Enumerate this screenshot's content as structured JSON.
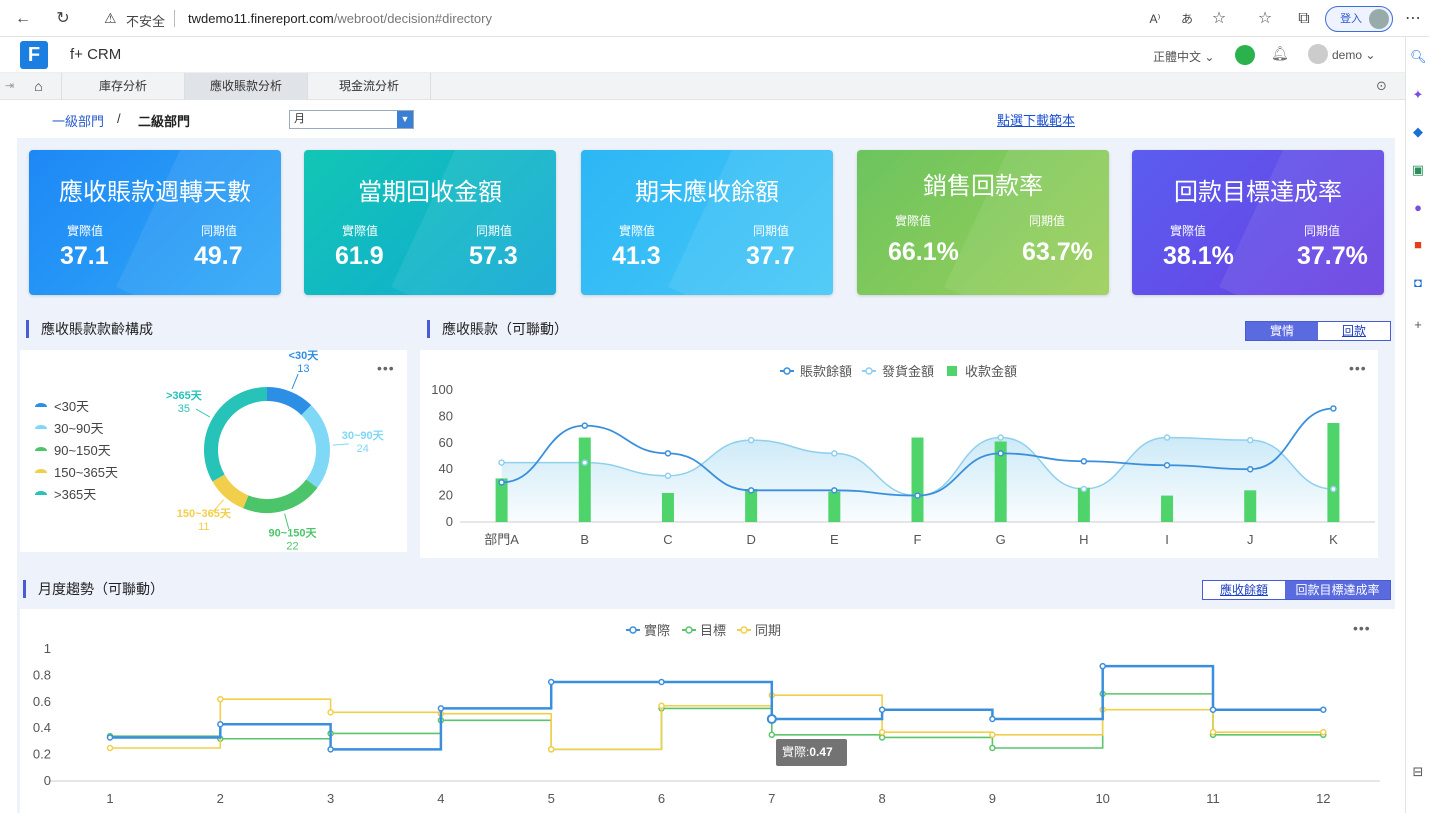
{
  "browser": {
    "insecure_label": "不安全",
    "url_host": "twdemo11.finereport.com",
    "url_path": "/webroot/decision#directory",
    "login_label": "登入"
  },
  "header": {
    "app_title": "f+ CRM",
    "language": "正體中文",
    "username": "demo"
  },
  "tabs": [
    {
      "label": "庫存分析",
      "active": false
    },
    {
      "label": "應收賬款分析",
      "active": true
    },
    {
      "label": "現金流分析",
      "active": false
    }
  ],
  "filters": {
    "breadcrumb_1": "一級部門",
    "breadcrumb_sep": "/",
    "breadcrumb_2": "二級部門",
    "period_value": "月",
    "download_link": "點選下載範本"
  },
  "kpis": [
    {
      "title": "應收賬款週轉天數",
      "actual_label": "實際值",
      "actual": "37.1",
      "prior_label": "同期值",
      "prior": "49.7",
      "color_a": "#1e88f5",
      "color_b": "#2fa8f7"
    },
    {
      "title": "當期回收金額",
      "actual_label": "實際值",
      "actual": "61.9",
      "prior_label": "同期值",
      "prior": "57.3",
      "color_a": "#12c6b4",
      "color_b": "#10a8d6"
    },
    {
      "title": "期末應收餘額",
      "actual_label": "實際值",
      "actual": "41.3",
      "prior_label": "同期值",
      "prior": "37.7",
      "color_a": "#2cb6f5",
      "color_b": "#46c8f7"
    },
    {
      "title": "銷售回款率",
      "actual_label": "實際值",
      "actual": "66.1%",
      "prior_label": "同期值",
      "prior": "63.7%",
      "color_a": "#6cc45e",
      "color_b": "#9ccf5a"
    },
    {
      "title": "回款目標達成率",
      "actual_label": "實際值",
      "actual": "38.1%",
      "prior_label": "同期值",
      "prior": "37.7%",
      "color_a": "#5a5ef0",
      "color_b": "#6a3ee0"
    }
  ],
  "sections": {
    "aging_title": "應收賬款款齡構成",
    "receivables_title": "應收賬款（可聯動）",
    "monthly_title": "月度趨勢（可聯動）",
    "receivables_toggle": [
      "實情",
      "回款"
    ],
    "monthly_toggle": [
      "應收餘額",
      "回款目標達成率"
    ],
    "more_icon": "•••"
  },
  "tooltip": {
    "label": "實際:",
    "value": "0.47"
  },
  "chart_data": [
    {
      "type": "pie",
      "title": "應收賬款款齡構成",
      "categories": [
        "<30天",
        "30~90天",
        "90~150天",
        "150~365天",
        ">365天"
      ],
      "values": [
        13,
        24,
        22,
        11,
        35
      ],
      "colors": [
        "#2d8ee6",
        "#7fd8f5",
        "#4cc46a",
        "#f2cf4a",
        "#27c2b8"
      ]
    },
    {
      "type": "bar",
      "title": "應收賬款（可聯動）",
      "categories": [
        "部門A",
        "B",
        "C",
        "D",
        "E",
        "F",
        "G",
        "H",
        "I",
        "J",
        "K"
      ],
      "ylim": [
        0,
        100
      ],
      "yticks": [
        0,
        20,
        40,
        60,
        80,
        100
      ],
      "series": [
        {
          "name": "賬款餘額",
          "kind": "line",
          "color": "#3a8fdc",
          "values": [
            30,
            73,
            52,
            24,
            24,
            20,
            52,
            46,
            43,
            40,
            86
          ]
        },
        {
          "name": "發貨金額",
          "kind": "area",
          "color": "#8fd0ee",
          "values": [
            45,
            45,
            35,
            62,
            52,
            20,
            64,
            25,
            64,
            62,
            25
          ]
        },
        {
          "name": "收款金額",
          "kind": "bar",
          "color": "#4fd46c",
          "values": [
            33,
            64,
            22,
            25,
            23,
            64,
            61,
            26,
            20,
            24,
            75
          ]
        }
      ]
    },
    {
      "type": "line",
      "title": "月度趨勢（可聯動）",
      "x": [
        1,
        2,
        3,
        4,
        5,
        6,
        7,
        8,
        9,
        10,
        11,
        12
      ],
      "ylim": [
        0,
        1
      ],
      "yticks": [
        0,
        0.2,
        0.4,
        0.6,
        0.8,
        1
      ],
      "step": true,
      "series": [
        {
          "name": "實際",
          "color": "#3a8fdc",
          "values": [
            0.33,
            0.43,
            0.24,
            0.55,
            0.75,
            0.75,
            0.47,
            0.54,
            0.47,
            0.87,
            0.54,
            0.54
          ]
        },
        {
          "name": "目標",
          "color": "#5cc46a",
          "values": [
            0.34,
            0.32,
            0.36,
            0.46,
            0.24,
            0.55,
            0.35,
            0.33,
            0.25,
            0.66,
            0.35,
            0.35
          ]
        },
        {
          "name": "同期",
          "color": "#f2cf4a",
          "values": [
            0.25,
            0.62,
            0.52,
            0.51,
            0.24,
            0.57,
            0.65,
            0.37,
            0.35,
            0.54,
            0.37,
            0.37
          ]
        }
      ]
    }
  ]
}
